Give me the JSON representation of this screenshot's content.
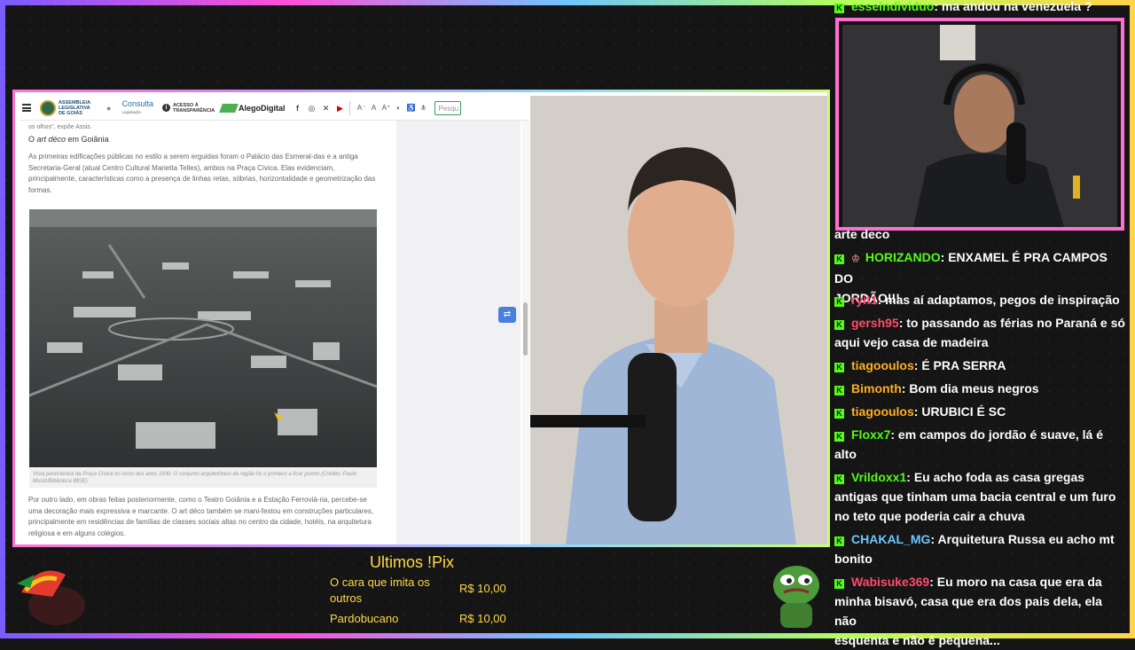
{
  "site": {
    "logo_text": "ASSEMBLEIA LEGISLATIVA DE GOIÁS",
    "consulta": "Consulta",
    "consulta_sub": "Legislação",
    "transparencia": "ACESSO À TRANSPARÊNCIA",
    "alego_digital": "AlegoDigital",
    "search_placeholder": "Pesqu"
  },
  "article": {
    "snippet": "os olhos\", expõe Assis.",
    "heading_pre": "O ",
    "heading_em": "art déco",
    "heading_post": " em Goiânia",
    "para1": "As primeiras edificações públicas no estilo a serem erguidas foram o Palácio das Esmeral-das e a antiga Secretaria-Geral (atual Centro Cultural Marietta Telles), ambos na Praça Cívica. Elas evidenciam, principalmente, características como a presença de linhas retas, sóbrias, horizontalidade e geometrização das formas.",
    "caption": "Vista panorâmica da Praça Cívica no início dos anos 1930. O conjunto arquitetônico da região foi o primeiro a ficar pronto (Crédito: Paulo Muniz/Biblioteca IBGE)",
    "para2": "Por outro lado, em obras feitas posteriormente, como o Teatro Goiânia e a Estação Ferroviá-ria, percebe-se uma decoração mais expressiva e marcante. O art déco também se mani-festou em construções particulares, principalmente em residências de famílias de classes sociais altas no centro da cidade, hotéis, na arquitetura religiosa e em alguns colégios."
  },
  "pix": {
    "title": "Ultimos !Pix",
    "rows": [
      {
        "name_line1": "O cara que imita os",
        "name_line2": "outros",
        "amount": "R$ 10,00"
      },
      {
        "name_line1": "Pardobucano",
        "name_line2": "",
        "amount": "R$ 10,00"
      }
    ]
  },
  "chat": {
    "messages": [
      {
        "user": "esseindividuo",
        "color": "#53fc18",
        "text": ": ma andou na venezuela ?",
        "cont": ""
      },
      {
        "user": "",
        "color": "#ffffff",
        "text": "arte deco",
        "cont": ""
      },
      {
        "user": "HORIZANDO",
        "color": "#53fc18",
        "text": ": ENXAMEL É PRA CAMPOS DO",
        "cont": "JORDÃO!!!"
      },
      {
        "user": "ryit1",
        "color": "#ff4d6a",
        "text": ": mas aí adaptamos, pegos de inspiração",
        "cont": ""
      },
      {
        "user": "gersh95",
        "color": "#ff4d6a",
        "text": ": to passando as férias no Paraná e só",
        "cont": "aqui vejo casa de madeira"
      },
      {
        "user": "tiagooulos",
        "color": "#ffb020",
        "text": ": É PRA SERRA",
        "cont": ""
      },
      {
        "user": "Bimonth",
        "color": "#ffb020",
        "text": ": Bom dia meus negros",
        "cont": ""
      },
      {
        "user": "tiagooulos",
        "color": "#ffb020",
        "text": ": URUBICI É SC",
        "cont": ""
      },
      {
        "user": "Floxx7",
        "color": "#53fc18",
        "text": ": em campos do jordão é suave, lá é",
        "cont": "alto"
      },
      {
        "user": "Vrildoxx1",
        "color": "#53fc18",
        "text": ": Eu acho foda as casa gregas",
        "cont": "antigas que tinham uma bacia central e um furo",
        "cont2": "no teto que poderia cair a chuva"
      },
      {
        "user": "CHAKAL_MG",
        "color": "#6ec6ff",
        "text": ": Arquitetura Russa eu acho mt",
        "cont": "bonito"
      },
      {
        "user": "Wabisuke369",
        "color": "#ff4d6a",
        "text": ": Eu moro na casa que era da",
        "cont": "minha bisavó, casa que era dos pais dela, ela não",
        "cont2": "esquenta e não é pequena..."
      }
    ]
  }
}
